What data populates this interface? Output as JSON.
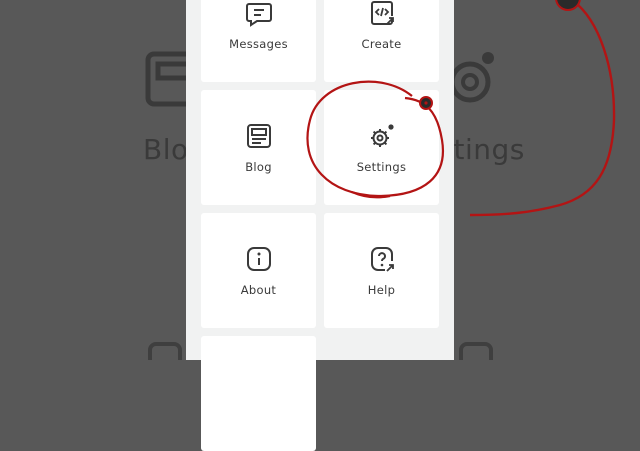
{
  "menu": {
    "tiles": [
      {
        "label": "Messages",
        "icon": "message-icon"
      },
      {
        "label": "Create",
        "icon": "code-file-icon"
      },
      {
        "label": "Blog",
        "icon": "blog-icon"
      },
      {
        "label": "Settings",
        "icon": "gear-icon"
      },
      {
        "label": "About",
        "icon": "info-icon"
      },
      {
        "label": "Help",
        "icon": "help-icon"
      }
    ]
  },
  "background": {
    "left_text": "Blo",
    "right_text": "ttings"
  },
  "colors": {
    "annotation": "#b31414",
    "panel": "#f1f2f2",
    "tile": "#ffffff",
    "icon": "#3a3a3a",
    "backdrop": "#585858"
  }
}
